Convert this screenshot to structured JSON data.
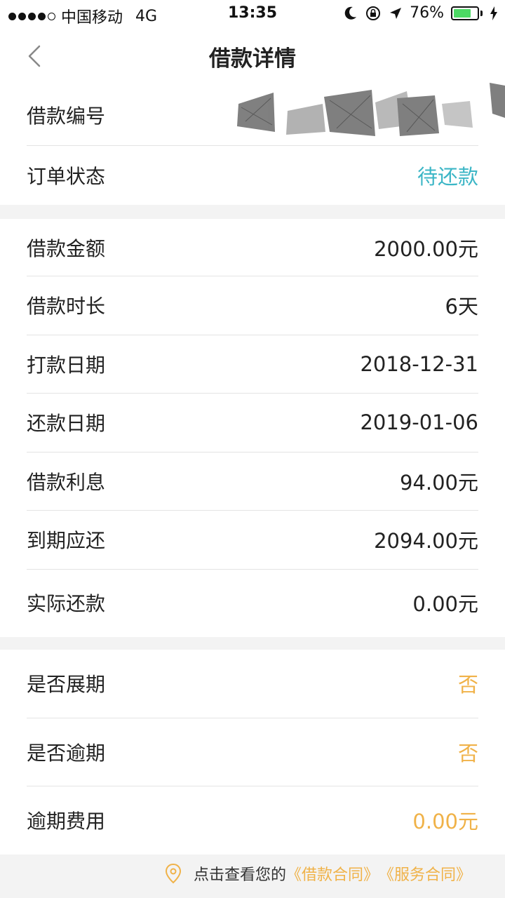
{
  "status_bar": {
    "carrier": "中国移动",
    "network": "4G",
    "time": "13:35",
    "battery_percent": "76%",
    "battery_level": 0.76,
    "battery_color": "#4cd964"
  },
  "nav": {
    "title": "借款详情",
    "back_icon": "chevron-left-icon"
  },
  "loan_info": {
    "loan_number_label": "借款编号",
    "order_status_label": "订单状态",
    "order_status_value": "待还款"
  },
  "details": [
    {
      "label": "借款金额",
      "value": "2000.00元"
    },
    {
      "label": "借款时长",
      "value": "6天"
    },
    {
      "label": "打款日期",
      "value": "2018-12-31"
    },
    {
      "label": "还款日期",
      "value": "2019-01-06"
    },
    {
      "label": "借款利息",
      "value": "94.00元"
    },
    {
      "label": "到期应还",
      "value": "2094.00元"
    },
    {
      "label": "实际还款",
      "value": "0.00元"
    }
  ],
  "overdue": [
    {
      "label": "是否展期",
      "value": "否"
    },
    {
      "label": "是否逾期",
      "value": "否"
    },
    {
      "label": "逾期费用",
      "value": "0.00元"
    }
  ],
  "footer": {
    "prefix": "点击查看您的",
    "loan_contract_link": "《借款合同》",
    "service_contract_link": "《服务合同》"
  },
  "colors": {
    "accent_teal": "#3cb6c6",
    "accent_orange": "#f0b248",
    "background": "#f3f3f3"
  }
}
